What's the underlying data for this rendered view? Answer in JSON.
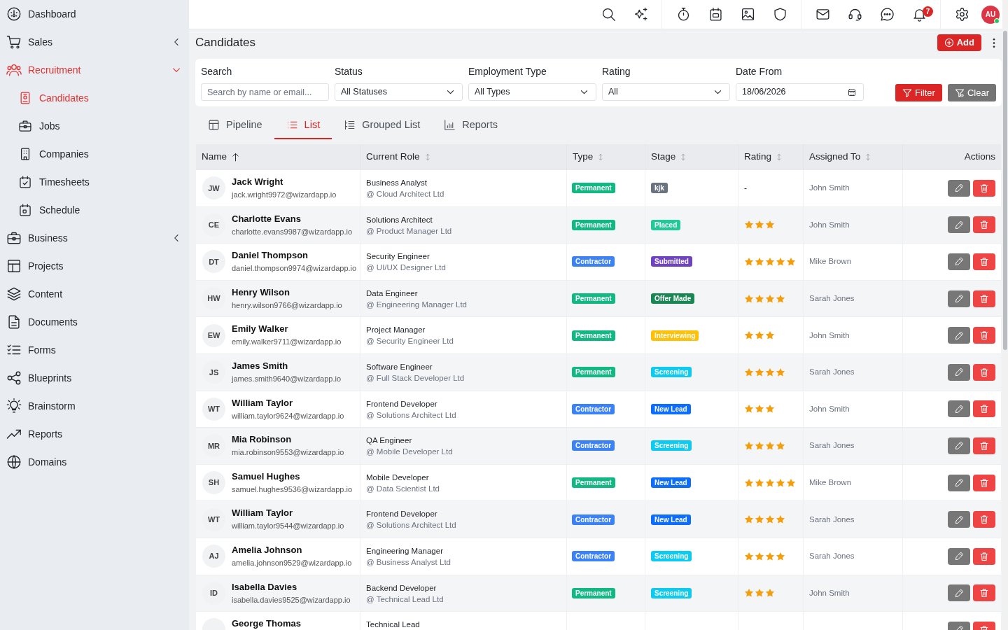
{
  "sidebar": {
    "items": [
      {
        "label": "Dashboard",
        "kind": "link",
        "selected": false
      },
      {
        "label": "Sales",
        "kind": "group",
        "expanded": false,
        "selected": false
      },
      {
        "label": "Recruitment",
        "kind": "group",
        "expanded": true,
        "selected": true,
        "children": [
          {
            "label": "Candidates",
            "selected": true
          },
          {
            "label": "Jobs",
            "selected": false
          },
          {
            "label": "Companies",
            "selected": false
          },
          {
            "label": "Timesheets",
            "selected": false
          },
          {
            "label": "Schedule",
            "selected": false
          }
        ]
      },
      {
        "label": "Business",
        "kind": "group",
        "expanded": false,
        "selected": false
      },
      {
        "label": "Projects",
        "kind": "link",
        "selected": false
      },
      {
        "label": "Content",
        "kind": "link",
        "selected": false
      },
      {
        "label": "Documents",
        "kind": "link",
        "selected": false
      },
      {
        "label": "Forms",
        "kind": "link",
        "selected": false
      },
      {
        "label": "Blueprints",
        "kind": "link",
        "selected": false
      },
      {
        "label": "Brainstorm",
        "kind": "link",
        "selected": false
      },
      {
        "label": "Reports",
        "kind": "link",
        "selected": false
      },
      {
        "label": "Domains",
        "kind": "link",
        "selected": false
      }
    ]
  },
  "top_bar": {
    "notification_count": "7",
    "user_initials": "AU",
    "user_online": true
  },
  "page_header": {
    "title": "Candidates",
    "add_button": "Add"
  },
  "filters": {
    "fields": [
      {
        "label": "Search",
        "kind": "text",
        "placeholder": "Search by name or email..."
      },
      {
        "label": "Status",
        "kind": "select",
        "value": "All Statuses"
      },
      {
        "label": "Employment Type",
        "kind": "select",
        "value": "All Types"
      },
      {
        "label": "Rating",
        "kind": "select",
        "value": "All"
      },
      {
        "label": "Date From",
        "kind": "date",
        "value": "18/06/2026"
      }
    ],
    "buttons": [
      {
        "label": "Filter",
        "kind": "primary"
      },
      {
        "label": "Clear",
        "kind": "secondary"
      }
    ]
  },
  "view_tabs": [
    {
      "label": "Pipeline",
      "selected": false
    },
    {
      "label": "List",
      "selected": true
    },
    {
      "label": "Grouped List",
      "selected": false
    },
    {
      "label": "Reports",
      "selected": false
    }
  ],
  "table": {
    "columns": [
      {
        "label": "Name",
        "kind": "sorted"
      },
      {
        "label": "Current Role",
        "kind": "sortable"
      },
      {
        "label": "Type",
        "kind": "sortable"
      },
      {
        "label": "Stage",
        "kind": "sortable"
      },
      {
        "label": "Rating",
        "kind": "sortable"
      },
      {
        "label": "Assigned To",
        "kind": "sortable"
      },
      {
        "label": "Actions",
        "kind": "plain"
      }
    ],
    "rows": [
      {
        "initials": "JW",
        "name": "Jack Wright",
        "email": "jack.wright9972@wizardapp.io",
        "role": "Business Analyst",
        "company": "@ Cloud Architect Ltd",
        "type": {
          "label": "Permanent",
          "color": "#10b981"
        },
        "stage": {
          "label": "kjk",
          "color": "#6b7280"
        },
        "rating_text": "-",
        "assigned_to": "John Smith"
      },
      {
        "initials": "CE",
        "name": "Charlotte Evans",
        "email": "charlotte.evans9987@wizardapp.io",
        "role": "Solutions Architect",
        "company": "@ Product Manager Ltd",
        "type": {
          "label": "Permanent",
          "color": "#10b981"
        },
        "stage": {
          "label": "Placed",
          "color": "#20c997"
        },
        "stars": 3,
        "assigned_to": "John Smith"
      },
      {
        "initials": "DT",
        "name": "Daniel Thompson",
        "email": "daniel.thompson9974@wizardapp.io",
        "role": "Security Engineer",
        "company": "@ UI/UX Designer Ltd",
        "type": {
          "label": "Contractor",
          "color": "#3b82f6"
        },
        "stage": {
          "label": "Submitted",
          "color": "#6f42c1"
        },
        "stars": 5,
        "assigned_to": "Mike Brown"
      },
      {
        "initials": "HW",
        "name": "Henry Wilson",
        "email": "henry.wilson9766@wizardapp.io",
        "role": "Data Engineer",
        "company": "@ Engineering Manager Ltd",
        "type": {
          "label": "Permanent",
          "color": "#10b981"
        },
        "stage": {
          "label": "Offer Made",
          "color": "#198754"
        },
        "stars": 4,
        "assigned_to": "Sarah Jones"
      },
      {
        "initials": "EW",
        "name": "Emily Walker",
        "email": "emily.walker9711@wizardapp.io",
        "role": "Project Manager",
        "company": "@ Security Engineer Ltd",
        "type": {
          "label": "Permanent",
          "color": "#10b981"
        },
        "stage": {
          "label": "Interviewing",
          "color": "#ffc107"
        },
        "stars": 3,
        "assigned_to": "John Smith"
      },
      {
        "initials": "JS",
        "name": "James Smith",
        "email": "james.smith9640@wizardapp.io",
        "role": "Software Engineer",
        "company": "@ Full Stack Developer Ltd",
        "type": {
          "label": "Permanent",
          "color": "#10b981"
        },
        "stage": {
          "label": "Screening",
          "color": "#0dcaf0"
        },
        "stars": 4,
        "assigned_to": "Sarah Jones"
      },
      {
        "initials": "WT",
        "name": "William Taylor",
        "email": "william.taylor9624@wizardapp.io",
        "role": "Frontend Developer",
        "company": "@ Solutions Architect Ltd",
        "type": {
          "label": "Contractor",
          "color": "#3b82f6"
        },
        "stage": {
          "label": "New Lead",
          "color": "#0d6efd"
        },
        "stars": 3,
        "assigned_to": "John Smith"
      },
      {
        "initials": "MR",
        "name": "Mia Robinson",
        "email": "mia.robinson9553@wizardapp.io",
        "role": "QA Engineer",
        "company": "@ Mobile Developer Ltd",
        "type": {
          "label": "Contractor",
          "color": "#3b82f6"
        },
        "stage": {
          "label": "Screening",
          "color": "#0dcaf0"
        },
        "stars": 4,
        "assigned_to": "Sarah Jones"
      },
      {
        "initials": "SH",
        "name": "Samuel Hughes",
        "email": "samuel.hughes9536@wizardapp.io",
        "role": "Mobile Developer",
        "company": "@ Data Scientist Ltd",
        "type": {
          "label": "Permanent",
          "color": "#10b981"
        },
        "stage": {
          "label": "New Lead",
          "color": "#0d6efd"
        },
        "stars": 5,
        "assigned_to": "Mike Brown"
      },
      {
        "initials": "WT",
        "name": "William Taylor",
        "email": "william.taylor9544@wizardapp.io",
        "role": "Frontend Developer",
        "company": "@ Solutions Architect Ltd",
        "type": {
          "label": "Contractor",
          "color": "#3b82f6"
        },
        "stage": {
          "label": "New Lead",
          "color": "#0d6efd"
        },
        "stars": 4,
        "assigned_to": "Sarah Jones"
      },
      {
        "initials": "AJ",
        "name": "Amelia Johnson",
        "email": "amelia.johnson9529@wizardapp.io",
        "role": "Engineering Manager",
        "company": "@ Business Analyst Ltd",
        "type": {
          "label": "Contractor",
          "color": "#3b82f6"
        },
        "stage": {
          "label": "Screening",
          "color": "#0dcaf0"
        },
        "stars": 4,
        "assigned_to": "Sarah Jones"
      },
      {
        "initials": "ID",
        "name": "Isabella Davies",
        "email": "isabella.davies9525@wizardapp.io",
        "role": "Backend Developer",
        "company": "@ Technical Lead Ltd",
        "type": {
          "label": "Permanent",
          "color": "#10b981"
        },
        "stage": {
          "label": "Screening",
          "color": "#0dcaf0"
        },
        "stars": 3,
        "assigned_to": "John Smith"
      },
      {
        "name": "George Thomas",
        "role": "Technical Lead"
      }
    ]
  }
}
